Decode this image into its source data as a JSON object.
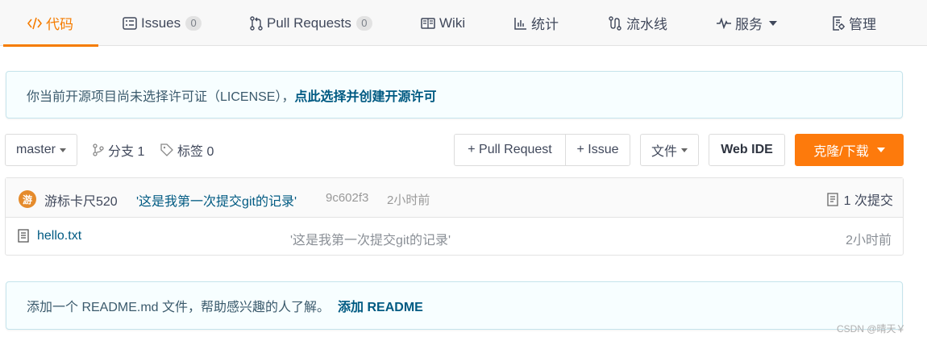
{
  "nav": {
    "tabs": [
      {
        "label": "代码",
        "icon": "code-icon"
      },
      {
        "label": "Issues",
        "icon": "issues-icon",
        "count": "0"
      },
      {
        "label": "Pull Requests",
        "icon": "pull-request-icon",
        "count": "0"
      },
      {
        "label": "Wiki",
        "icon": "wiki-icon"
      },
      {
        "label": "统计",
        "icon": "chart-icon"
      },
      {
        "label": "流水线",
        "icon": "pipeline-icon"
      },
      {
        "label": "服务",
        "icon": "pulse-icon"
      },
      {
        "label": "管理",
        "icon": "manage-icon"
      }
    ]
  },
  "license_banner": {
    "text": "你当前开源项目尚未选择许可证（LICENSE），",
    "link": "点此选择并创建开源许可"
  },
  "toolbar": {
    "branch": "master",
    "branches_label": "分支 1",
    "tags_label": "标签 0",
    "pull_request_button": "+ Pull Request",
    "issue_button": "+ Issue",
    "file_button": "文件",
    "web_ide_button": "Web IDE",
    "clone_button": "克隆/下载"
  },
  "commit": {
    "avatar_char": "游",
    "author": "游标卡尺520",
    "message": "'这是我第一次提交git的记录'",
    "hash": "9c602f3",
    "time": "2小时前",
    "commits_label": "1 次提交"
  },
  "files": [
    {
      "name": "hello.txt",
      "message": "'这是我第一次提交git的记录'",
      "time": "2小时前"
    }
  ],
  "readme_banner": {
    "text": "添加一个 README.md 文件，帮助感兴趣的人了解。",
    "link": "添加 README"
  },
  "watermark": "CSDN @晴天￥",
  "colors": {
    "accent": "#f57c00",
    "clone_button": "#fd7a0c",
    "link": "#005a82",
    "banner_bg": "#f7feff"
  }
}
